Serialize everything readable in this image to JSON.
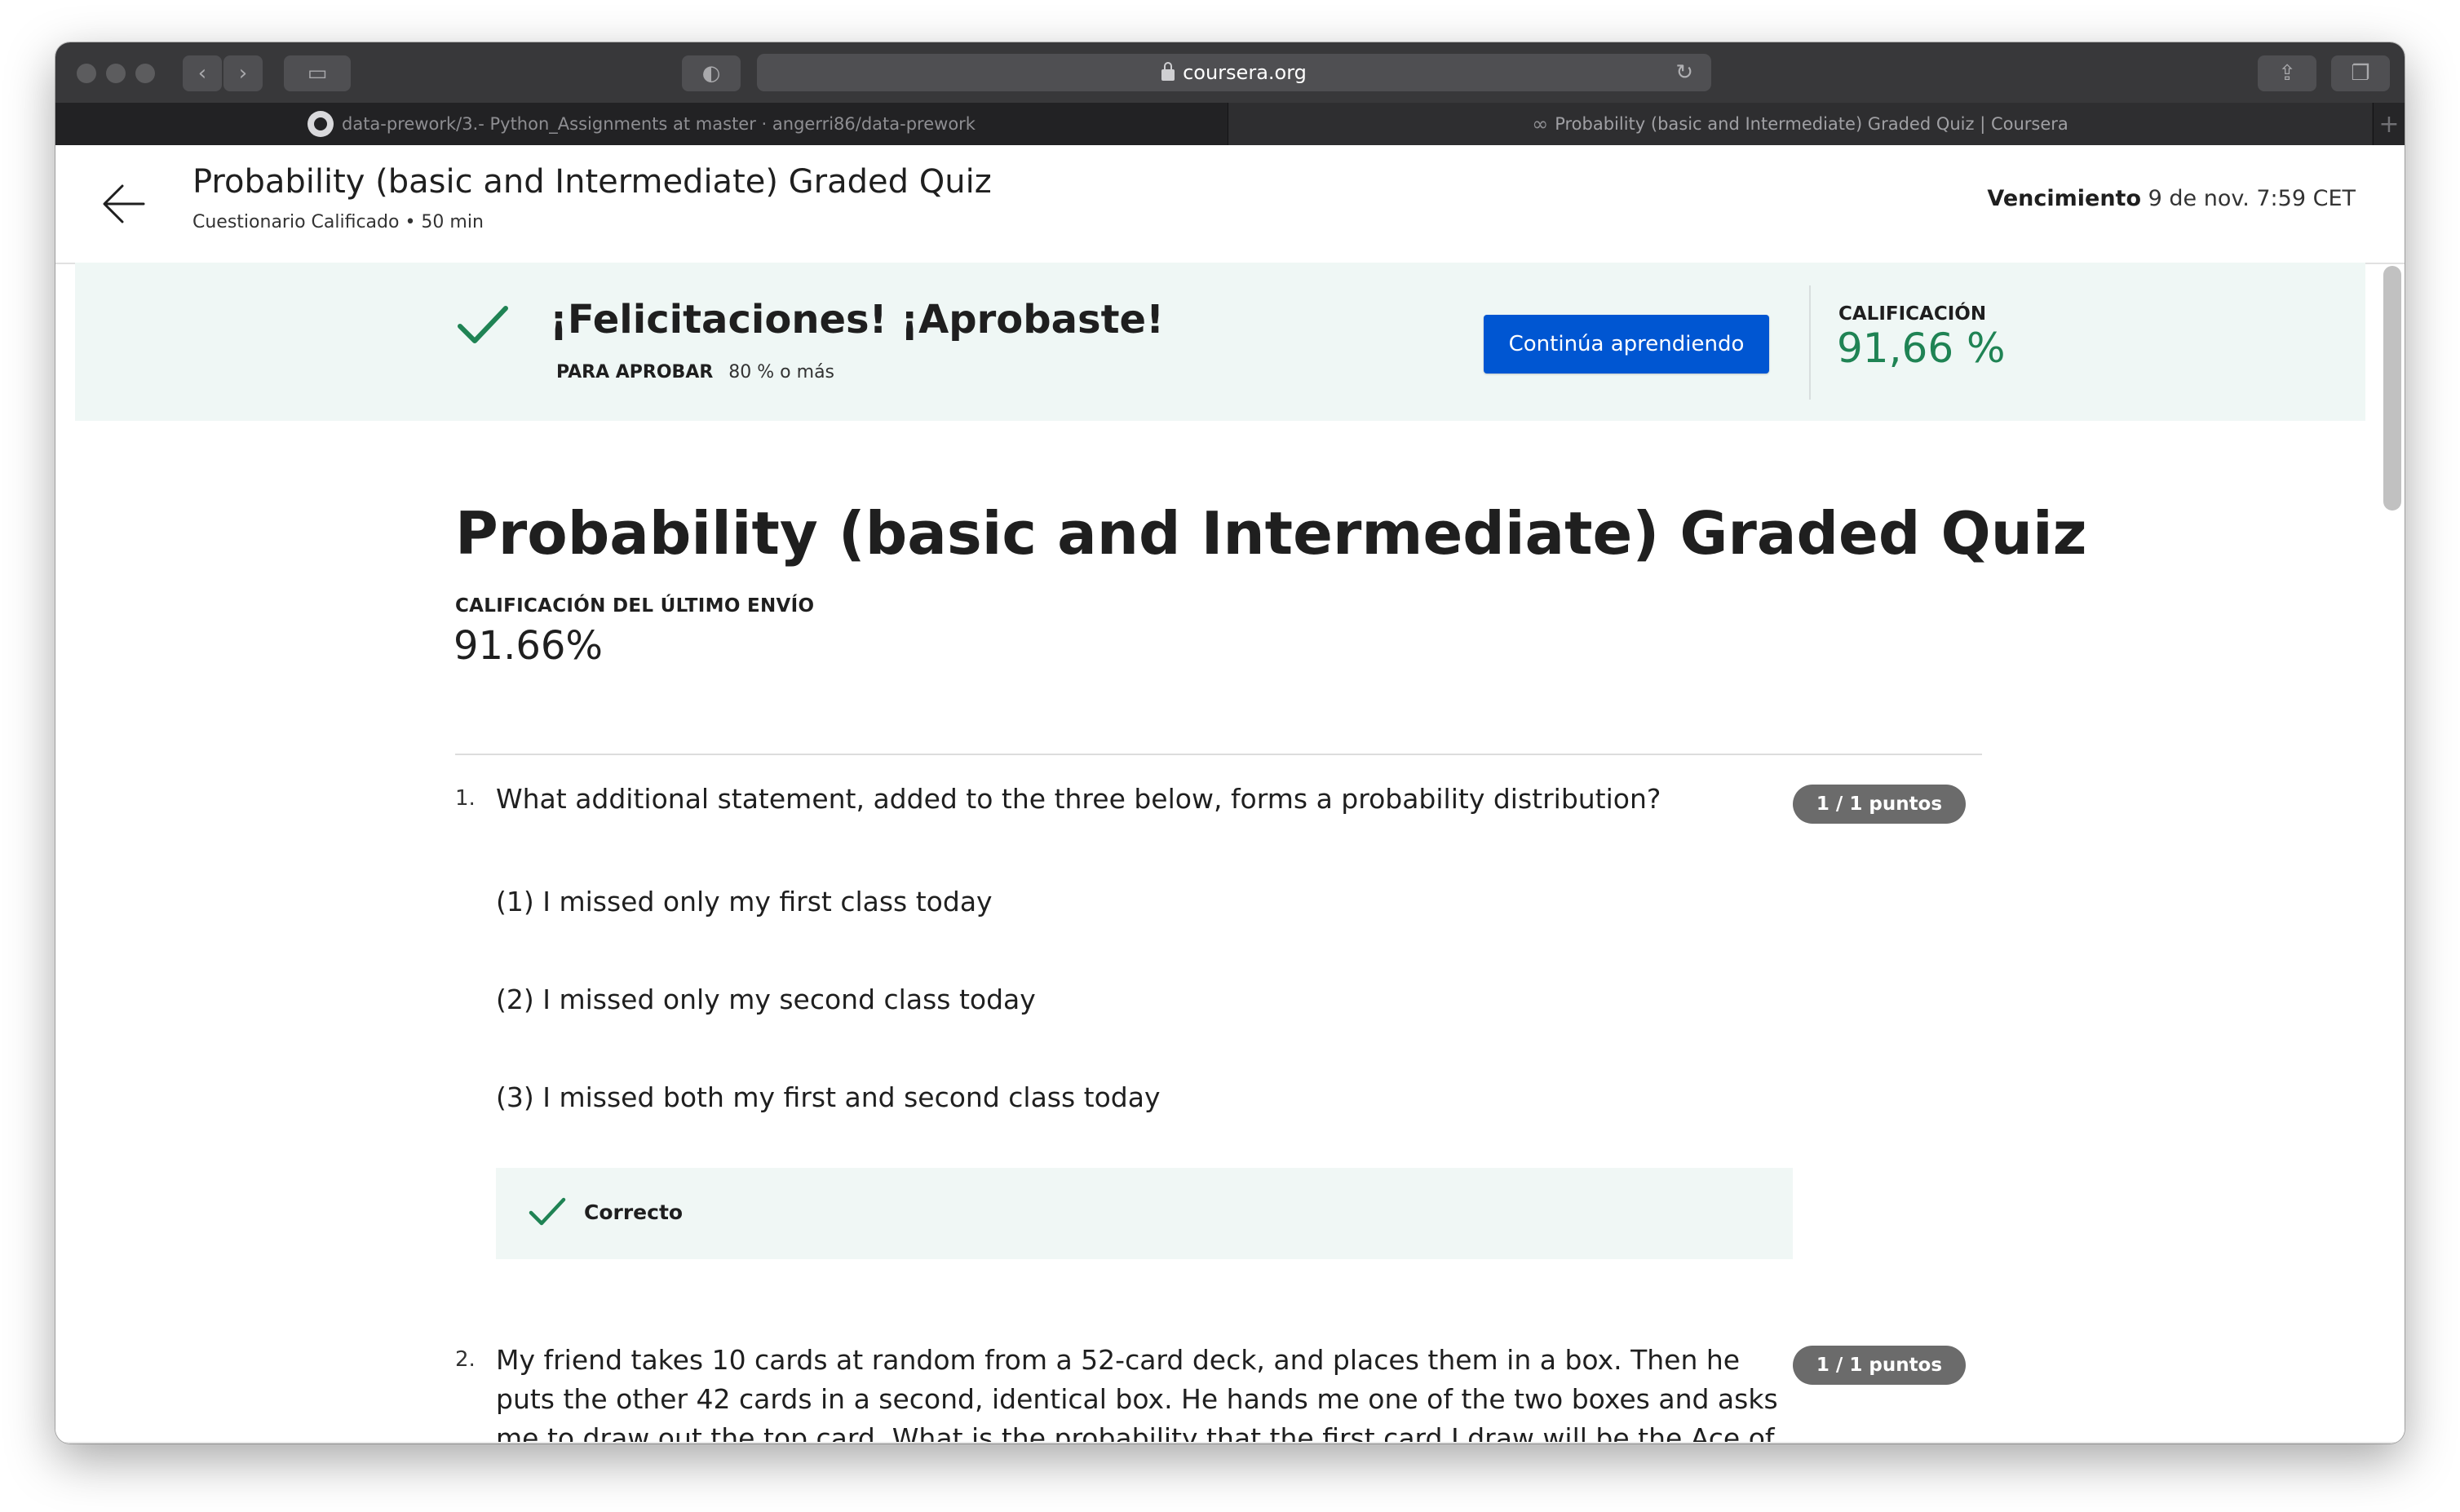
{
  "browser": {
    "url": "coursera.org",
    "tabs": [
      {
        "label": "data-prework/3.- Python_Assignments at master · angerri86/data-prework",
        "icon": "github-icon"
      },
      {
        "label": "Probability (basic and Intermediate) Graded Quiz | Coursera",
        "icon": "link-icon"
      }
    ]
  },
  "header": {
    "title": "Probability (basic and Intermediate) Graded Quiz",
    "subtitle": "Cuestionario Calificado • 50 min",
    "due_label": "Vencimiento",
    "due_value": "9 de nov. 7:59 CET"
  },
  "banner": {
    "title": "¡Felicitaciones! ¡Aprobaste!",
    "pass_label": "PARA APROBAR",
    "pass_value": "80 % o más",
    "continue_label": "Continúa aprendiendo",
    "grade_label": "CALIFICACIÓN",
    "grade_value": "91,66 %",
    "accent": "#1f8354",
    "button_color": "#0056d2"
  },
  "quiz": {
    "title": "Probability (basic and Intermediate) Graded Quiz",
    "last_submission_label": "CALIFICACIÓN DEL ÚLTIMO ENVÍO",
    "last_submission_value": "91.66%",
    "questions": [
      {
        "number": "1.",
        "text": "What additional statement, added to the three below, forms a probability distribution?",
        "points": "1 / 1 puntos",
        "options": [
          "(1) I missed only my first class today",
          "(2) I missed only my second class today",
          "(3) I missed both my first and second class today"
        ],
        "feedback": "Correcto"
      },
      {
        "number": "2.",
        "text": "My friend takes 10 cards at random from a 52-card deck, and places them in a box. Then he puts the other 42 cards in a second, identical box. He hands me one of the two boxes and asks me to draw out the top card. What is the probability that the first card I draw will be the Ace of Spades?",
        "points": "1 / 1 puntos"
      }
    ]
  }
}
